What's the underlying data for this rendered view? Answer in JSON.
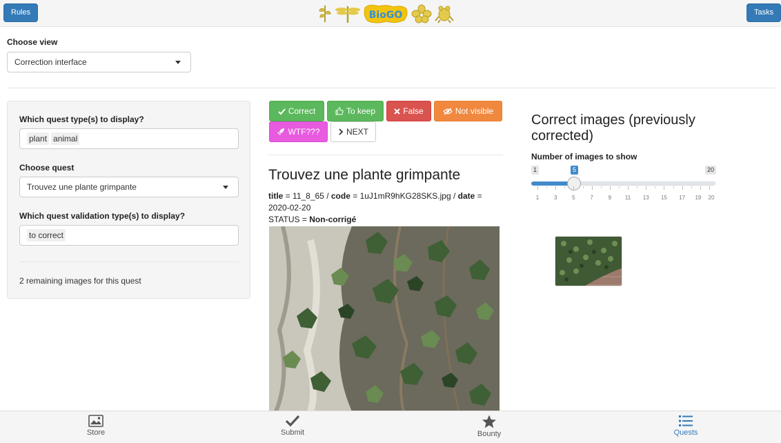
{
  "header": {
    "rules_label": "Rules",
    "tasks_label": "Tasks",
    "logo_text": "BioGO"
  },
  "view": {
    "label": "Choose view",
    "selected": "Correction interface"
  },
  "filters": {
    "quest_type_label": "Which quest type(s) to display?",
    "quest_types": [
      "plant",
      "animal"
    ],
    "quest_label": "Choose quest",
    "quest_selected": "Trouvez une plante grimpante",
    "validation_label": "Which quest validation type(s) to display?",
    "validation_types": [
      "to correct"
    ],
    "remaining": "2 remaining images for this quest"
  },
  "actions": {
    "correct": "Correct",
    "keep": "To keep",
    "false": "False",
    "not_visible": "Not visible",
    "wtf": "WTF???",
    "next": "NEXT"
  },
  "quest": {
    "title": "Trouvez une plante grimpante",
    "title_key": "title",
    "title_value": "11_8_65",
    "code_key": "code",
    "code_value": "1uJ1mR9hKG28SKS.jpg",
    "date_key": "date",
    "date_value": "2020-02-20",
    "status_key": "STATUS",
    "status_value": "Non-corrigé"
  },
  "correct_images": {
    "title": "Correct images (previously corrected)",
    "slider_label": "Number of images to show",
    "slider_min": "1",
    "slider_max": "20",
    "slider_value": "5",
    "tick_labels": [
      "1",
      "3",
      "5",
      "7",
      "9",
      "11",
      "13",
      "15",
      "17",
      "19",
      "20"
    ]
  },
  "tabs": [
    {
      "label": "Store",
      "icon": "image-icon"
    },
    {
      "label": "Submit",
      "icon": "check-icon"
    },
    {
      "label": "Bounty",
      "icon": "star-icon"
    },
    {
      "label": "Quests",
      "icon": "list-icon",
      "active": true
    }
  ],
  "colors": {
    "primary": "#337ab7",
    "success": "#5cb85c",
    "danger": "#d9534f",
    "warning": "#f0883e",
    "magenta": "#e85ae0"
  }
}
